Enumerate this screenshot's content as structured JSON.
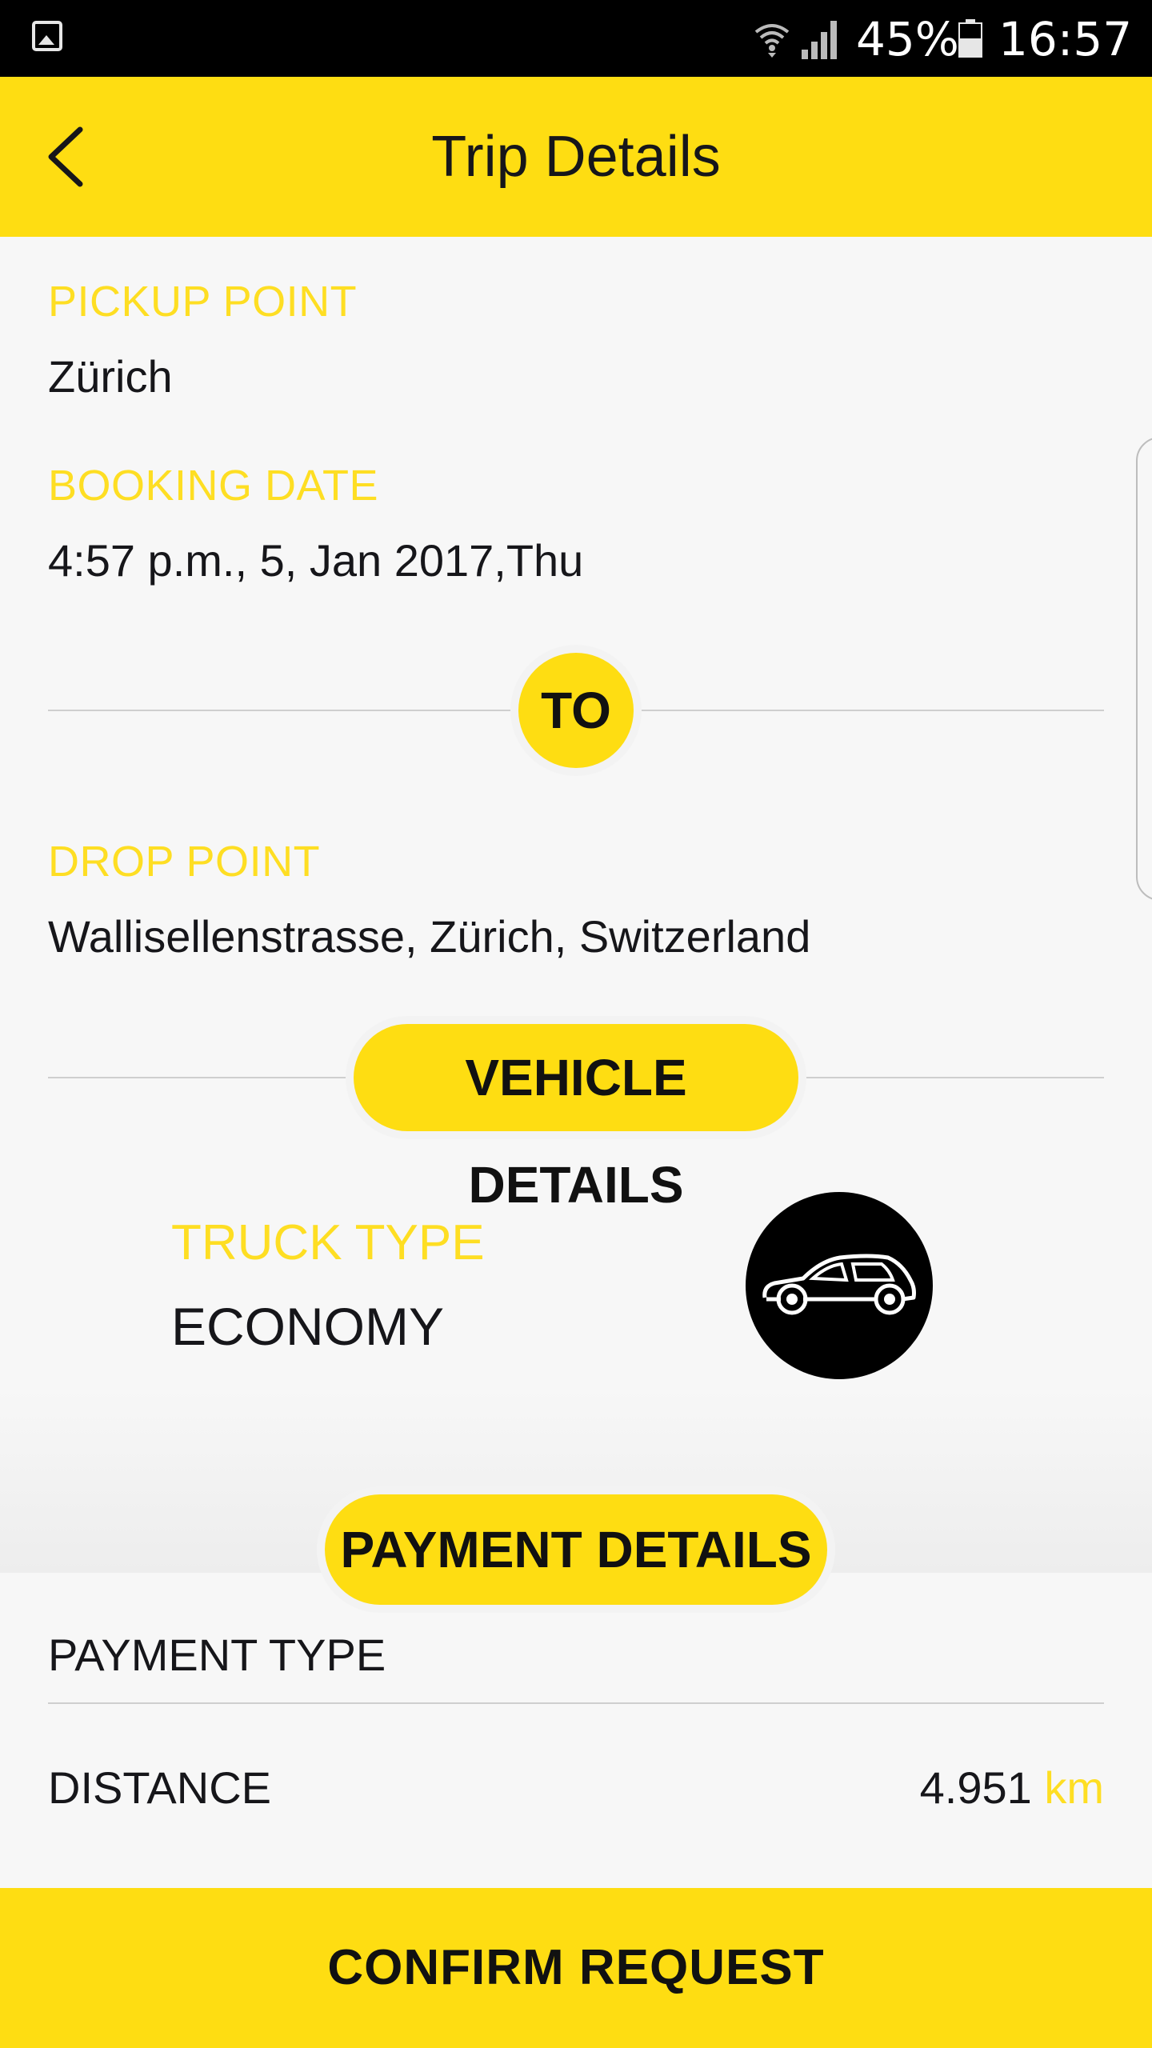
{
  "status_bar": {
    "battery_percent": "45%",
    "time": "16:57",
    "icons": [
      "gallery-icon",
      "wifi-icon",
      "signal-icon",
      "battery-icon"
    ]
  },
  "app_bar": {
    "title": "Trip Details",
    "back_icon": "chevron-left-icon"
  },
  "pickup": {
    "label": "PICKUP POINT",
    "value": "Zürich"
  },
  "booking": {
    "label": "BOOKING DATE",
    "value": "4:57 p.m., 5, Jan 2017,Thu"
  },
  "separator": {
    "to_label": "TO"
  },
  "drop": {
    "label": "DROP POINT",
    "value": "Wallisellenstrasse, Zürich, Switzerland"
  },
  "vehicle": {
    "section_title": "VEHICLE DETAILS",
    "type_label": "TRUCK TYPE",
    "type_value": "ECONOMY",
    "icon": "car-icon"
  },
  "payment": {
    "section_title": "PAYMENT DETAILS",
    "rows": [
      {
        "label": "PAYMENT TYPE",
        "value": ""
      },
      {
        "label": "DISTANCE",
        "value": "4.951",
        "unit": "km"
      }
    ]
  },
  "footer": {
    "confirm_label": "CONFIRM REQUEST"
  },
  "colors": {
    "accent": "#fedd12",
    "label_yellow": "#fede23",
    "text": "#16161a",
    "background": "#f7f7f7",
    "status_bar": "#000000"
  }
}
